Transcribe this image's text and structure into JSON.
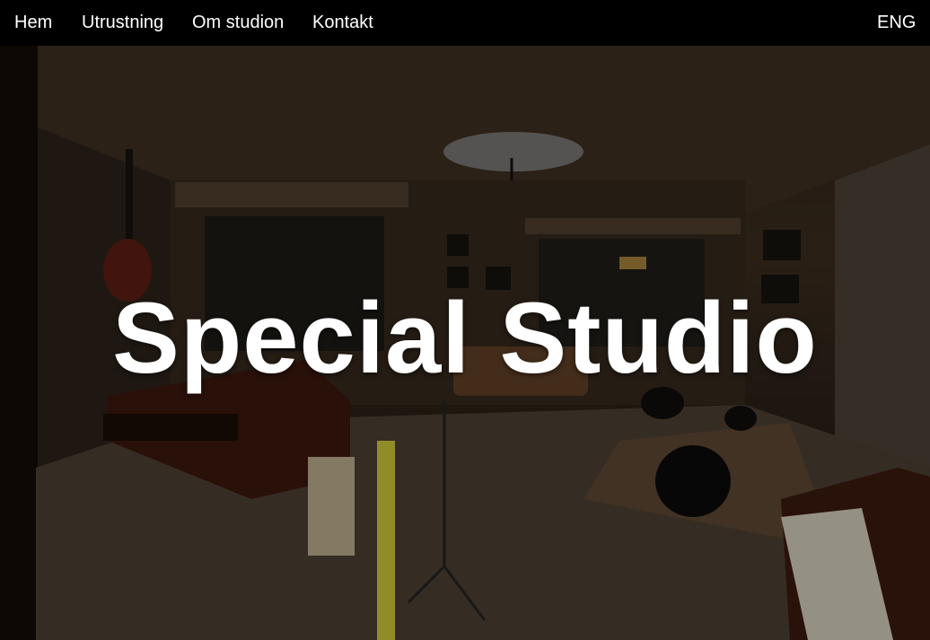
{
  "nav": {
    "items": [
      {
        "label": "Hem"
      },
      {
        "label": "Utrustning"
      },
      {
        "label": "Om studion"
      },
      {
        "label": "Kontakt"
      }
    ],
    "language": "ENG"
  },
  "hero": {
    "title": "Special Studio"
  },
  "colors": {
    "nav_background": "#000000",
    "nav_text": "#ffffff",
    "title_text": "#ffffff"
  }
}
